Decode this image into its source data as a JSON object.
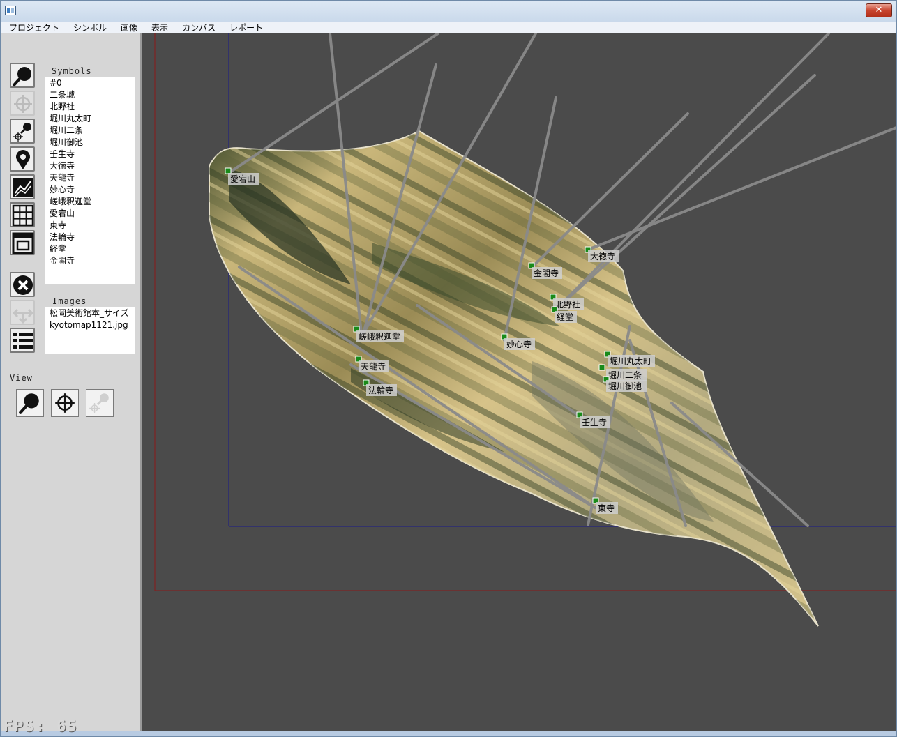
{
  "menu": [
    "プロジェクト",
    "シンボル",
    "画像",
    "表示",
    "カンバス",
    "レポート"
  ],
  "titlebar": {
    "close": "✕"
  },
  "panel": {
    "symbols_label": "Symbols",
    "symbols": [
      "#0",
      "二条城",
      "北野社",
      "堀川丸太町",
      "堀川二条",
      "堀川御池",
      "壬生寺",
      "大徳寺",
      "天龍寺",
      "妙心寺",
      "嵯峨釈迦堂",
      "愛宕山",
      "東寺",
      "法輪寺",
      "経堂",
      "金閣寺"
    ],
    "images_label": "Images",
    "images": [
      "松岡美術館本_サイズ",
      "kyotomap1121.jpg"
    ],
    "view_label": "View"
  },
  "markers": {
    "atagoyama": "愛宕山",
    "daitokuji": "大徳寺",
    "kinkakuji": "金閣寺",
    "kitanosha": "北野社",
    "kyodo": "経堂",
    "saga_shakado": "嵯峨釈迦堂",
    "myoshinji": "妙心寺",
    "tenryuji": "天龍寺",
    "horinji": "法輪寺",
    "horikawa_marutamachi": "堀川丸太町",
    "horikawa_nijo": "堀川二条",
    "horikawa_oike": "堀川御池",
    "mibudera": "壬生寺",
    "toji": "東寺"
  },
  "fps_text": "FPS:  65",
  "colors": {
    "canvas_bg": "#4b4b4b",
    "panel_bg": "#d6d6d6",
    "frame_red": "#8b1a1a",
    "frame_blue": "#1a1a8b",
    "ray_gray": "#8a8a8a",
    "marker_green": "#1a8a1a"
  },
  "icons": {
    "tools": [
      "magnifier-icon",
      "crosshair-icon",
      "magnifier-crosshair-icon",
      "map-pin-icon",
      "chart-icon",
      "grid-icon",
      "window-icon",
      "delete-icon",
      "move-icon",
      "list-icon"
    ],
    "view": [
      "magnifier-icon",
      "crosshair-icon",
      "magnifier-crosshair-icon"
    ]
  }
}
